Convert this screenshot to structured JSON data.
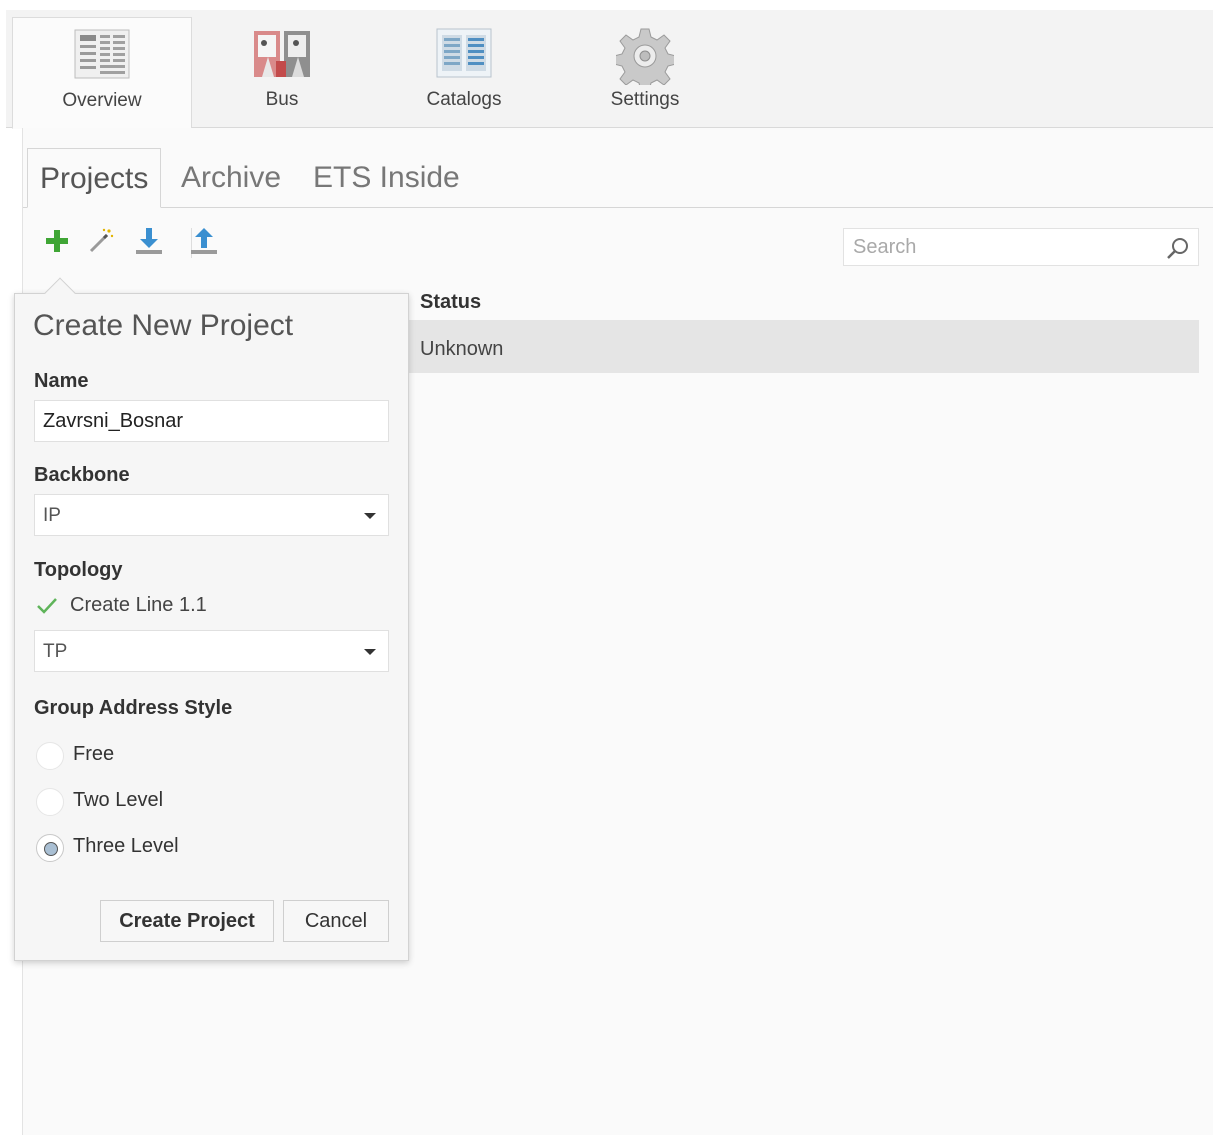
{
  "ribbon": {
    "tabs": [
      {
        "label": "Overview",
        "icon": "overview-icon",
        "active": true
      },
      {
        "label": "Bus",
        "icon": "bus-icon",
        "active": false
      },
      {
        "label": "Catalogs",
        "icon": "catalogs-icon",
        "active": false
      },
      {
        "label": "Settings",
        "icon": "settings-gear-icon",
        "active": false
      }
    ]
  },
  "subtabs": [
    {
      "label": "Projects",
      "active": true
    },
    {
      "label": "Archive",
      "active": false
    },
    {
      "label": "ETS Inside",
      "active": false
    }
  ],
  "toolbar": {
    "items": [
      "add-icon",
      "wizard-icon",
      "import-icon",
      "export-icon"
    ],
    "accent_green": "#3fa535",
    "accent_blue": "#3a8fd0"
  },
  "search": {
    "placeholder": "Search",
    "value": ""
  },
  "table": {
    "columns": [
      "Status"
    ],
    "rows": [
      {
        "status": "Unknown"
      }
    ]
  },
  "create_project": {
    "title": "Create New Project",
    "name_label": "Name",
    "name_value": "Zavrsni_Bosnar",
    "backbone_label": "Backbone",
    "backbone_value": "IP",
    "topology_label": "Topology",
    "create_line_label": "Create Line 1.1",
    "create_line_checked": true,
    "topology_medium_value": "TP",
    "group_address_label": "Group Address Style",
    "group_address_options": [
      {
        "label": "Free",
        "checked": false
      },
      {
        "label": "Two Level",
        "checked": false
      },
      {
        "label": "Three Level",
        "checked": true
      }
    ],
    "create_button": "Create Project",
    "cancel_button": "Cancel"
  }
}
